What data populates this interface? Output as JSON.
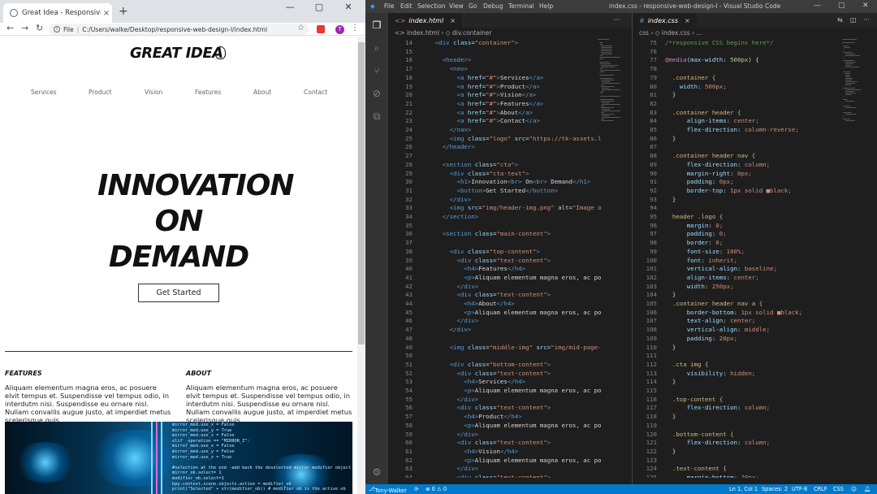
{
  "browser": {
    "tab_title": "Great Idea - Responsive I",
    "tab_close": "×",
    "new_tab": "+",
    "address_file_label": "File",
    "address_url": "C:/Users/walke/Desktop/responsive-web-design-l/index.html",
    "profile_initial": "T",
    "window_controls": [
      "—",
      "▢",
      "✕"
    ]
  },
  "site": {
    "logo_text": "GREAT IDEA",
    "nav": [
      "Services",
      "Product",
      "Vision",
      "Features",
      "About",
      "Contact"
    ],
    "hero_lines": [
      "INNOVATION",
      "ON",
      "DEMAND"
    ],
    "cta_label": "Get Started",
    "columns": [
      {
        "heading": "FEATURES",
        "body": "Aliquam elementum magna eros, ac posuere elvit tempus et. Suspendisse vel tempus odio, in interdutm nisi. Suspendisse eu ornare nisl. Nullam convallis augue justo, at imperdiet metus scelerisque quis."
      },
      {
        "heading": "ABOUT",
        "body": "Aliquam elementum magna eros, ac posuere elvit tempus et. Suspendisse vel tempus odio, in interdutm nisi. Suspendisse eu ornare nisl. Nullam convallis augue justo, at imperdiet metus scelerisque quis."
      }
    ],
    "image_code": [
      "mirror_mod.use_x = False",
      "mirror_mod.use_y = True",
      "mirror_mod.use_z = False",
      "elif _operation == \"MIRROR_Z\":",
      "mirror_mod.use_x = False",
      "mirror_mod.use_y = False",
      "mirror_mod.use_z = True",
      "",
      "#selection at the end -add back the deselected mirror modifier object",
      "mirror_ob.select= 1",
      "modifier_ob.select=1",
      "bpy.context.scene.objects.active = modifier_ob",
      "print(\"Selected\" + str(modifier_ob)) # modifier ob is the active ob"
    ]
  },
  "vscode": {
    "menu": [
      "File",
      "Edit",
      "Selection",
      "View",
      "Go",
      "Debug",
      "Terminal",
      "Help"
    ],
    "window_title": "index.css - responsive-web-design-l - Visual Studio Code",
    "left_tab": "index.html",
    "left_breadcrumb": "<> index.html  ›  ◇ div.container",
    "right_tab": "index.css",
    "right_breadcrumb": "css  ›  ◇ index.css  ›  ...",
    "status": {
      "user": "Tony-Walker",
      "sync": "⟳",
      "problems": "⊗ 0 ⚠ 0",
      "position": "Ln 1, Col 1",
      "spaces": "Spaces: 2",
      "encoding": "UTF-8",
      "eol": "CRLF",
      "language": "CSS"
    },
    "html_start_line": 14,
    "html_lines": [
      "    <div class=\"container\">",
      "",
      "      <header>",
      "        <nav>",
      "          <a href=\"#\">Services</a>",
      "          <a href=\"#\">Product</a>",
      "          <a href=\"#\">Vision</a>",
      "          <a href=\"#\">Features</a>",
      "          <a href=\"#\">About</a>",
      "          <a href=\"#\">Contact</a>",
      "        </nav>",
      "        <img class=\"logo\" src=\"https://tk-assets.l",
      "      </header>",
      "",
      "      <section class=\"cta\">",
      "        <div class=\"cta-text\">",
      "          <h1>Innovation<br> On<br> Demand</h1>",
      "          <button>Get Started</button>",
      "        </div>",
      "        <img src=\"img/header-img.png\" alt=\"Image o",
      "      </section>",
      "",
      "      <section class=\"main-content\">",
      "",
      "        <div class=\"top-content\">",
      "          <div class=\"text-content\">",
      "            <h4>Features</h4>",
      "            <p>Aliquam elementum magna eros, ac po",
      "          </div>",
      "          <div class=\"text-content\">",
      "            <h4>About</h4>",
      "            <p>Aliquam elementum magna eros, ac po",
      "          </div>",
      "        </div>",
      "",
      "        <img class=\"middle-img\" src=\"img/mid-page-",
      "",
      "        <div class=\"bottom-content\">",
      "          <div class=\"text-content\">",
      "            <h4>Services</h4>",
      "            <p>Aliquam elementum magna eros, ac po",
      "          </div>",
      "          <div class=\"text-content\">",
      "            <h4>Product</h4>",
      "            <p>Aliquam elementum magna eros, ac po",
      "          </div>",
      "          <div class=\"text-content\">",
      "            <h4>Vision</h4>",
      "            <p>Aliquam elementum magna eros, ac po",
      "          </div>",
      "          <div class=\"text-content\">"
    ],
    "css_start_line": 75,
    "css_lines": [
      "/*responsive CSS begins here*/",
      "",
      "@media(max-width: 500px) {",
      "",
      "  .container {",
      "    width: 500px;",
      "  }",
      "",
      "  .container header {",
      "      align-items: center;",
      "      flex-direction: column-reverse;",
      "  }",
      "",
      "  .container header nav {",
      "      flex-direction: column;",
      "      margin-right: 0px;",
      "      padding: 0px;",
      "      border-top: 1px solid ■black;",
      "  }",
      "",
      "  header .logo {",
      "      margin: 0;",
      "      padding: 0;",
      "      border: 0;",
      "      font-size: 100%;",
      "      font: inherit;",
      "      vertical-align: baseline;",
      "      align-items: center;",
      "      width: 250px;",
      "  }",
      "  .container header nav a {",
      "      border-bottom: 1px solid ■black;",
      "      text-align: center;",
      "      vertical-align: middle;",
      "      padding: 20px;",
      "  }",
      "",
      "  .cta img {",
      "      visibility: hidden;",
      "  }",
      "",
      "  .top-content {",
      "      flex-direction: column;",
      "  }",
      "",
      "  .bottom-content {",
      "      flex-direction: column;",
      "  }",
      "",
      "  .text-content {",
      "      margin-bottom: 20px;"
    ]
  }
}
